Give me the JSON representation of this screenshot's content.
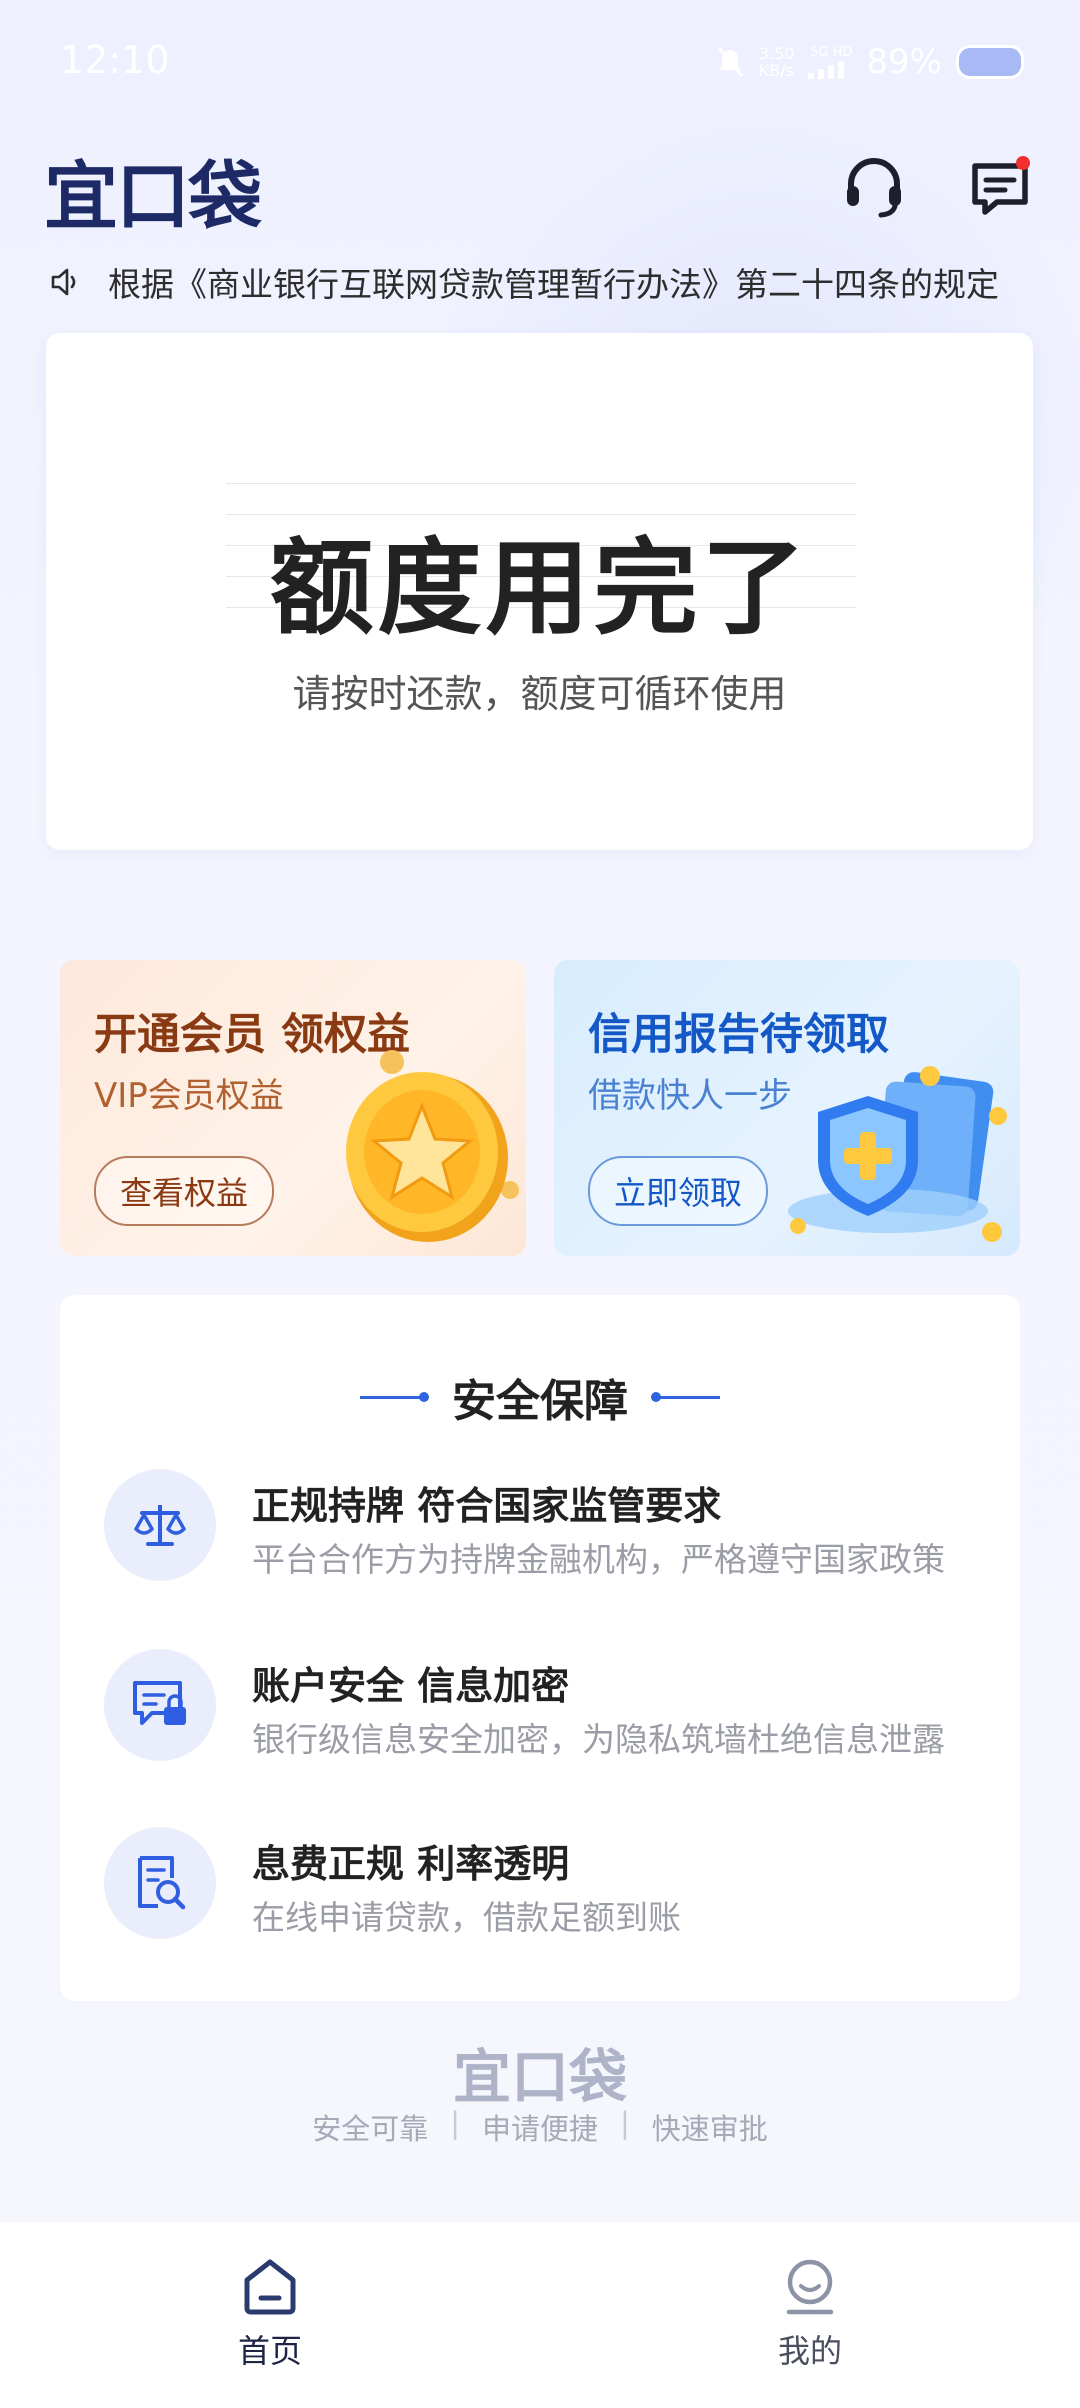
{
  "status_bar": {
    "time": "12:10",
    "net_speed_value": "3.50",
    "net_speed_unit": "KB/s",
    "signal_label": "5G HD",
    "battery": "89%"
  },
  "header": {
    "logo": "宜口袋",
    "service_icon": "headset-icon",
    "message_icon": "message-icon"
  },
  "notice": {
    "icon": "speaker-icon",
    "text": "根据《商业银行互联网贷款管理暂行办法》第二十四条的规定"
  },
  "quota": {
    "title": "额度用完了",
    "subtitle": "请按时还款，额度可循环使用"
  },
  "promos": {
    "vip": {
      "title": "开通会员 领权益",
      "subtitle": "VIP会员权益",
      "button": "查看权益"
    },
    "credit": {
      "title": "信用报告待领取",
      "subtitle": "借款快人一步",
      "button": "立即领取"
    }
  },
  "security": {
    "title": "安全保障",
    "items": [
      {
        "icon": "scale-icon",
        "title": "正规持牌 符合国家监管要求",
        "desc": "平台合作方为持牌金融机构，严格遵守国家政策"
      },
      {
        "icon": "secure-chat-icon",
        "title": "账户安全 信息加密",
        "desc": "银行级信息安全加密，为隐私筑墙杜绝信息泄露"
      },
      {
        "icon": "document-search-icon",
        "title": "息费正规  利率透明",
        "desc": "在线申请贷款，借款足额到账"
      }
    ]
  },
  "footer": {
    "logo": "宜口袋",
    "tags": [
      "安全可靠",
      "申请便捷",
      "快速审批"
    ]
  },
  "tabs": [
    {
      "label": "首页",
      "icon": "home-icon",
      "active": true
    },
    {
      "label": "我的",
      "icon": "profile-icon",
      "active": false
    }
  ],
  "colors": {
    "brand": "#1d2a66",
    "accent_blue": "#2d63e0",
    "vip_brown": "#8a3a13",
    "credit_blue": "#1458c8",
    "notification_dot": "#f2302f"
  }
}
